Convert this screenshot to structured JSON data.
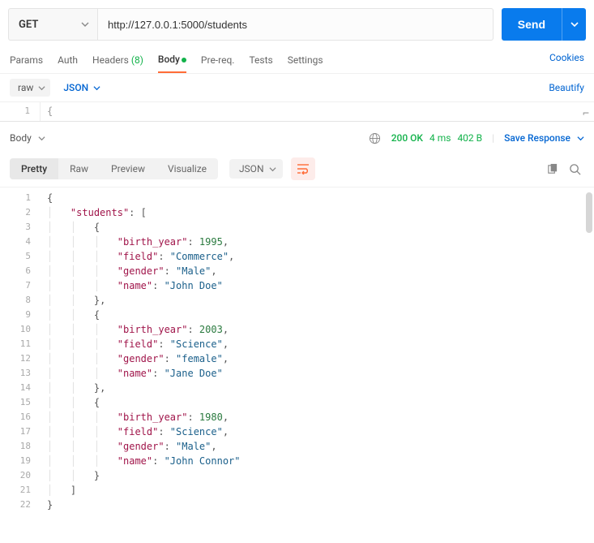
{
  "request": {
    "method": "GET",
    "url": "http://127.0.0.1:5000/students",
    "send_label": "Send"
  },
  "tabs": {
    "params": "Params",
    "auth": "Auth",
    "headers": "Headers",
    "headers_count": "(8)",
    "body": "Body",
    "prereq": "Pre-req.",
    "tests": "Tests",
    "settings": "Settings",
    "cookies": "Cookies"
  },
  "body_editor": {
    "mode": "raw",
    "format": "JSON",
    "beautify": "Beautify",
    "line1_num": "1",
    "line1_content": "{"
  },
  "response": {
    "label": "Body",
    "status_code": "200 OK",
    "time": "4 ms",
    "size": "402 B",
    "save": "Save Response"
  },
  "view": {
    "pretty": "Pretty",
    "raw": "Raw",
    "preview": "Preview",
    "visualize": "Visualize",
    "format": "JSON"
  },
  "code_lines": [
    {
      "n": 1,
      "ind": 0,
      "t": "brace",
      "text": "{"
    },
    {
      "n": 2,
      "ind": 1,
      "t": "kv",
      "key": "\"students\"",
      "after": ": ["
    },
    {
      "n": 3,
      "ind": 2,
      "t": "brace",
      "text": "{"
    },
    {
      "n": 4,
      "ind": 3,
      "t": "kvnum",
      "key": "\"birth_year\"",
      "val": "1995",
      "comma": true
    },
    {
      "n": 5,
      "ind": 3,
      "t": "kvstr",
      "key": "\"field\"",
      "val": "\"Commerce\"",
      "comma": true
    },
    {
      "n": 6,
      "ind": 3,
      "t": "kvstr",
      "key": "\"gender\"",
      "val": "\"Male\"",
      "comma": true
    },
    {
      "n": 7,
      "ind": 3,
      "t": "kvstr",
      "key": "\"name\"",
      "val": "\"John Doe\"",
      "comma": false
    },
    {
      "n": 8,
      "ind": 2,
      "t": "brace",
      "text": "},"
    },
    {
      "n": 9,
      "ind": 2,
      "t": "brace",
      "text": "{"
    },
    {
      "n": 10,
      "ind": 3,
      "t": "kvnum",
      "key": "\"birth_year\"",
      "val": "2003",
      "comma": true
    },
    {
      "n": 11,
      "ind": 3,
      "t": "kvstr",
      "key": "\"field\"",
      "val": "\"Science\"",
      "comma": true
    },
    {
      "n": 12,
      "ind": 3,
      "t": "kvstr",
      "key": "\"gender\"",
      "val": "\"female\"",
      "comma": true
    },
    {
      "n": 13,
      "ind": 3,
      "t": "kvstr",
      "key": "\"name\"",
      "val": "\"Jane Doe\"",
      "comma": false
    },
    {
      "n": 14,
      "ind": 2,
      "t": "brace",
      "text": "},"
    },
    {
      "n": 15,
      "ind": 2,
      "t": "brace",
      "text": "{"
    },
    {
      "n": 16,
      "ind": 3,
      "t": "kvnum",
      "key": "\"birth_year\"",
      "val": "1980",
      "comma": true
    },
    {
      "n": 17,
      "ind": 3,
      "t": "kvstr",
      "key": "\"field\"",
      "val": "\"Science\"",
      "comma": true
    },
    {
      "n": 18,
      "ind": 3,
      "t": "kvstr",
      "key": "\"gender\"",
      "val": "\"Male\"",
      "comma": true
    },
    {
      "n": 19,
      "ind": 3,
      "t": "kvstr",
      "key": "\"name\"",
      "val": "\"John Connor\"",
      "comma": false
    },
    {
      "n": 20,
      "ind": 2,
      "t": "brace",
      "text": "}"
    },
    {
      "n": 21,
      "ind": 1,
      "t": "brace",
      "text": "]"
    },
    {
      "n": 22,
      "ind": 0,
      "t": "brace",
      "text": "}"
    }
  ]
}
